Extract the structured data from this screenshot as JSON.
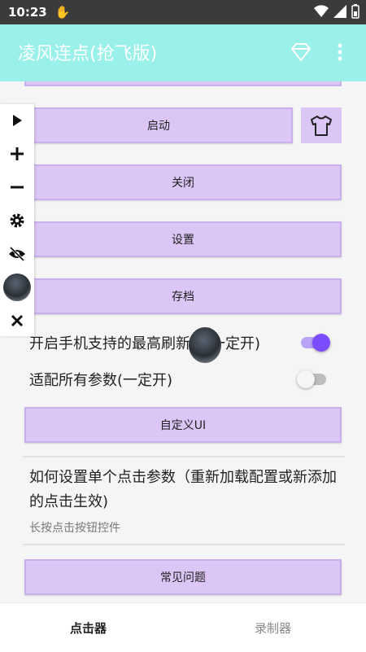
{
  "status_bar": {
    "time": "10:23"
  },
  "app_bar": {
    "title": "凌风连点(抢飞版)"
  },
  "buttons": {
    "start": "启动",
    "close": "关闭",
    "settings": "设置",
    "archive": "存档",
    "custom_ui": "自定义UI",
    "faq": "常见问题"
  },
  "toggles": [
    {
      "label": "开启手机支持的最高刷新率(一定开)",
      "state": "on"
    },
    {
      "label": "适配所有参数(一定开)",
      "state": "off"
    }
  ],
  "help": {
    "title": "如何设置单个点击参数（重新加载配置或新添加的点击生效)",
    "subtitle": "长按点击按钮控件"
  },
  "bottom_nav": {
    "clicker": "点击器",
    "recorder": "录制器"
  },
  "colors": {
    "app_bar": "#9af1ea",
    "button": "#dcc6f6",
    "toggle_on": "#7c4dff",
    "toggle_off": "#bdbdbd"
  }
}
